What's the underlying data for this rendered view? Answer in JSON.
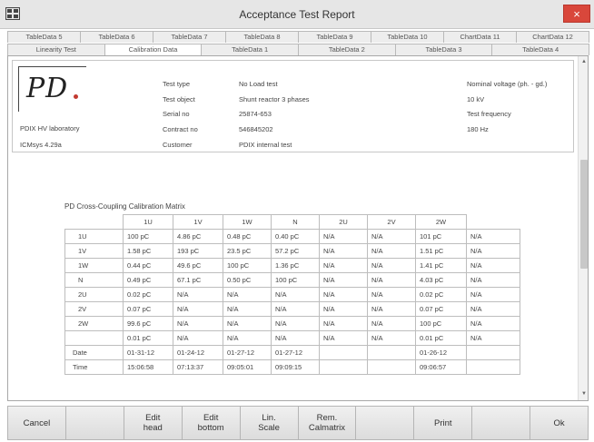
{
  "window": {
    "title": "Acceptance Test Report",
    "close_glyph": "×",
    "app_icon": "grid-app-icon"
  },
  "tabs_row1": [
    "TableData 5",
    "TableData 6",
    "TableData 7",
    "TableData 8",
    "TableData 9",
    "TableData 10",
    "ChartData 11",
    "ChartData 12"
  ],
  "tabs_row2": [
    "Linearity Test",
    "Calibration Data",
    "TableData 1",
    "TableData 2",
    "TableData 3",
    "TableData 4"
  ],
  "active_tab": "Calibration Data",
  "header": {
    "logo_text": "PD",
    "lab_name": "PDIX HV laboratory",
    "version": "ICMsys 4.29a",
    "fields": [
      {
        "label": "Test type",
        "value": "No Load test"
      },
      {
        "label": "Test object",
        "value": "Shunt reactor 3 phases"
      },
      {
        "label": "Serial no",
        "value": "25874-653"
      },
      {
        "label": "Contract no",
        "value": "546845202"
      },
      {
        "label": "Customer",
        "value": "PDIX internal test"
      }
    ],
    "nominal": [
      "Nominal voltage (ph. - gd.)",
      "10 kV",
      "Test frequency",
      "180 Hz"
    ]
  },
  "matrix": {
    "title": "PD Cross-Coupling Calibration Matrix",
    "columns": [
      "",
      "1U",
      "1V",
      "1W",
      "N",
      "2U",
      "2V",
      "2W",
      ""
    ],
    "rows": [
      [
        "1U",
        "100 pC",
        "4.86 pC",
        "0.48 pC",
        "0.40 pC",
        "N/A",
        "N/A",
        "101 pC",
        "N/A"
      ],
      [
        "1V",
        "1.58 pC",
        "193 pC",
        "23.5 pC",
        "57.2 pC",
        "N/A",
        "N/A",
        "1.51 pC",
        "N/A"
      ],
      [
        "1W",
        "0.44 pC",
        "49.6 pC",
        "100 pC",
        "1.36 pC",
        "N/A",
        "N/A",
        "1.41 pC",
        "N/A"
      ],
      [
        "N",
        "0.49 pC",
        "67.1 pC",
        "0.50 pC",
        "100 pC",
        "N/A",
        "N/A",
        "4.03 pC",
        "N/A"
      ],
      [
        "2U",
        "0.02 pC",
        "N/A",
        "N/A",
        "N/A",
        "N/A",
        "N/A",
        "0.02 pC",
        "N/A"
      ],
      [
        "2V",
        "0.07 pC",
        "N/A",
        "N/A",
        "N/A",
        "N/A",
        "N/A",
        "0.07 pC",
        "N/A"
      ],
      [
        "2W",
        "99.6 pC",
        "N/A",
        "N/A",
        "N/A",
        "N/A",
        "N/A",
        "100 pC",
        "N/A"
      ],
      [
        "",
        "0.01 pC",
        "N/A",
        "N/A",
        "N/A",
        "N/A",
        "N/A",
        "0.01 pC",
        "N/A"
      ],
      [
        "Date",
        "01-31-12",
        "01-24-12",
        "01-27-12",
        "01-27-12",
        "",
        "",
        "01-26-12",
        ""
      ],
      [
        "Time",
        "15:06:58",
        "07:13:37",
        "09:05:01",
        "09:09:15",
        "",
        "",
        "09:06:57",
        ""
      ]
    ]
  },
  "buttons": [
    "Cancel",
    "",
    "Edit\nhead",
    "Edit\nbottom",
    "Lin.\nScale",
    "Rem.\nCalmatrix",
    "",
    "Print",
    "",
    "Ok"
  ],
  "scrollbar": {
    "up_glyph": "▲",
    "down_glyph": "▼"
  }
}
